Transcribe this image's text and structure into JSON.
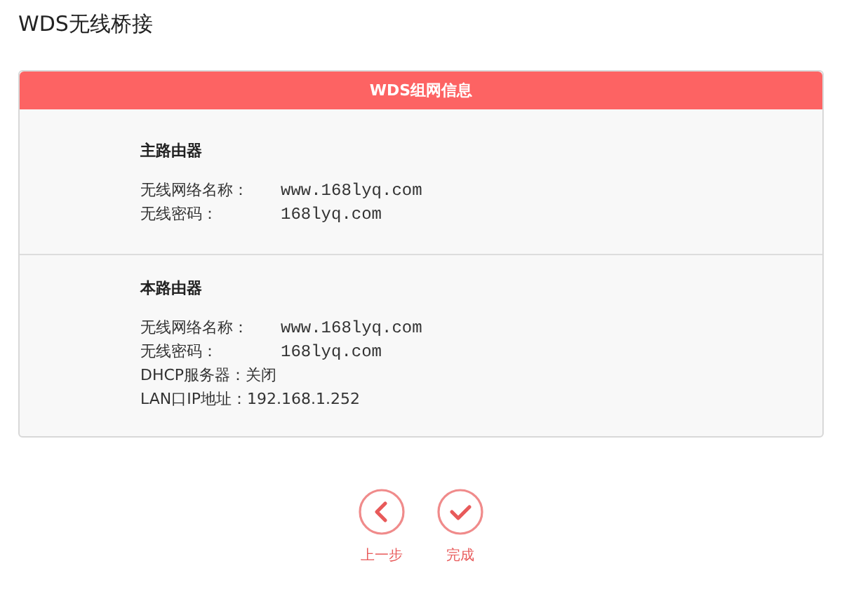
{
  "page_title": "WDS无线桥接",
  "panel": {
    "title": "WDS组网信息",
    "sections": [
      {
        "heading": "主路由器",
        "rows": [
          {
            "label": "无线网络名称：",
            "value": "www.168lyq.com",
            "mono": true
          },
          {
            "label": "无线密码：",
            "value": "168lyq.com",
            "mono": true
          }
        ]
      },
      {
        "heading": "本路由器",
        "rows": [
          {
            "label": "无线网络名称：",
            "value": "www.168lyq.com",
            "mono": true
          },
          {
            "label": "无线密码：",
            "value": "168lyq.com",
            "mono": true
          },
          {
            "label": "DHCP服务器：",
            "value": "关闭",
            "mono": false
          },
          {
            "label": "LAN口IP地址：",
            "value": "192.168.1.252",
            "mono": false
          }
        ]
      }
    ]
  },
  "buttons": [
    {
      "kind": "back",
      "label": "上一步"
    },
    {
      "kind": "finish",
      "label": "完成"
    }
  ]
}
